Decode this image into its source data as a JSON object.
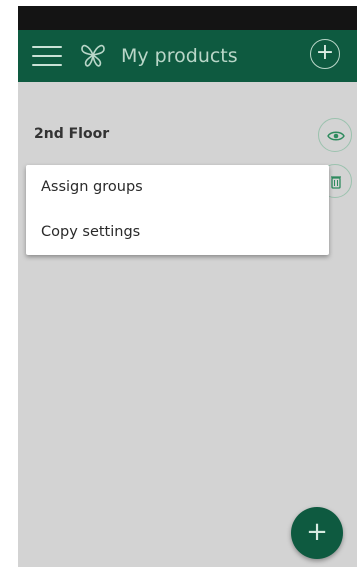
{
  "app_bar": {
    "title": "My products",
    "menu_icon": "hamburger-menu-icon",
    "logo_icon": "butterfly-logo-icon",
    "add_icon": "plus-circle-icon",
    "add_symbol": "+"
  },
  "list": {
    "items": [
      {
        "label": "2nd Floor",
        "view_icon": "eye-icon",
        "delete_icon": "trash-icon"
      }
    ]
  },
  "context_menu": {
    "items": [
      {
        "label": "Assign groups"
      },
      {
        "label": "Copy settings"
      }
    ]
  },
  "fab": {
    "symbol": "+",
    "icon": "plus-icon"
  },
  "colors": {
    "primary": "#0e5a40",
    "background_dim": "#d3d3d3",
    "status_bar": "#141414",
    "accent_light": "#9bc2ae"
  }
}
